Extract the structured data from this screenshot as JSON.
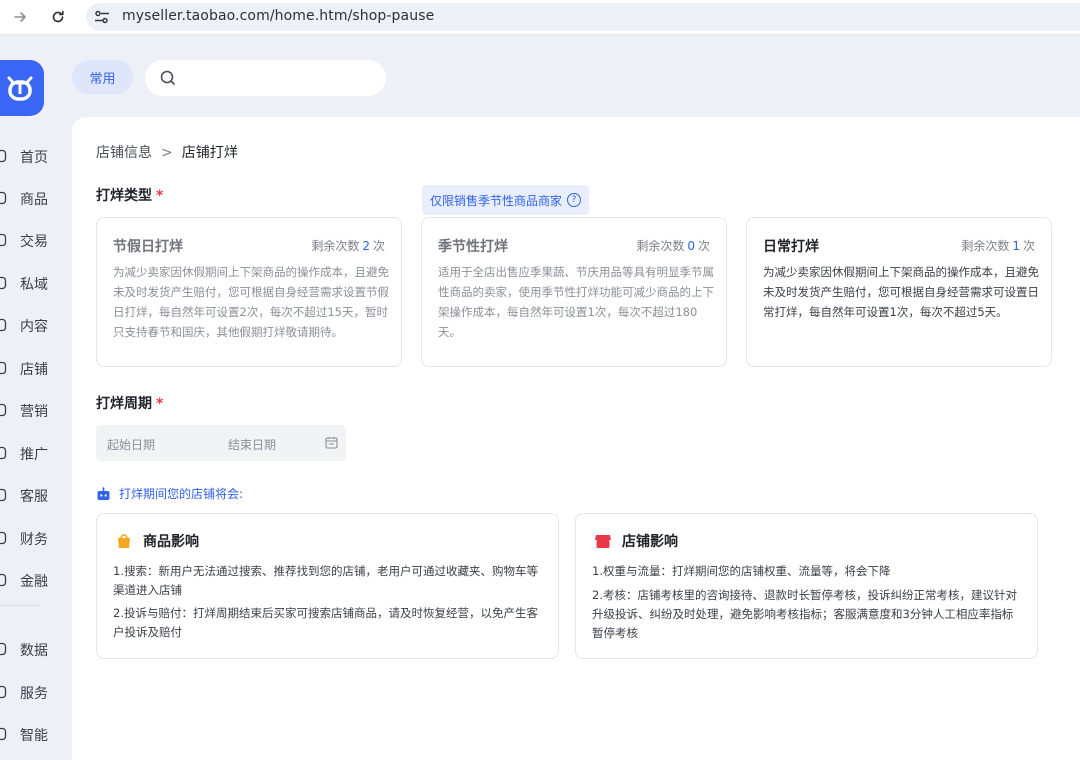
{
  "browser": {
    "url": "myseller.taobao.com/home.htm/shop-pause"
  },
  "sidebar": {
    "items": [
      {
        "label": "首页",
        "icon": "home-icon"
      },
      {
        "label": "商品",
        "icon": "goods-icon"
      },
      {
        "label": "交易",
        "icon": "trade-icon"
      },
      {
        "label": "私域",
        "icon": "private-domain-icon"
      },
      {
        "label": "内容",
        "icon": "content-icon"
      },
      {
        "label": "店铺",
        "icon": "shop-icon"
      },
      {
        "label": "营销",
        "icon": "marketing-icon"
      },
      {
        "label": "推广",
        "icon": "promotion-icon"
      },
      {
        "label": "客服",
        "icon": "service-icon"
      },
      {
        "label": "财务",
        "icon": "finance-icon"
      },
      {
        "label": "金融",
        "icon": "banking-icon"
      },
      {
        "label": "数据",
        "icon": "data-icon"
      },
      {
        "label": "服务",
        "icon": "services-icon"
      },
      {
        "label": "智能",
        "icon": "ai-icon"
      }
    ]
  },
  "toolbar": {
    "chip_label": "常用",
    "search_placeholder": ""
  },
  "breadcrumb": {
    "parent": "店铺信息",
    "separator": ">",
    "current": "店铺打烊"
  },
  "type_section": {
    "title": "打烊类型",
    "required_mark": "*",
    "seasonal_tag": "仅限销售季节性商品商家",
    "seasonal_tag_help": "?",
    "cards": [
      {
        "title": "节假日打烊",
        "remain_prefix": "剩余次数",
        "remain_count": "2",
        "remain_suffix": "次",
        "desc": "为减少卖家因休假期间上下架商品的操作成本，且避免未及时发货产生赔付，您可根据自身经营需求设置节假日打烊，每自然年可设置2次，每次不超过15天，暂时只支持春节和国庆，其他假期打烊敬请期待。",
        "active": false
      },
      {
        "title": "季节性打烊",
        "remain_prefix": "剩余次数",
        "remain_count": "0",
        "remain_suffix": "次",
        "desc": "适用于全店出售应季果蔬、节庆用品等具有明显季节属性商品的卖家，使用季节性打烊功能可减少商品的上下架操作成本，每自然年可设置1次，每次不超过180天。",
        "active": false
      },
      {
        "title": "日常打烊",
        "remain_prefix": "剩余次数",
        "remain_count": "1",
        "remain_suffix": "次",
        "desc": "为减少卖家因休假期间上下架商品的操作成本，且避免未及时发货产生赔付，您可根据自身经营需求可设置日常打烊，每自然年可设置1次，每次不超过5天。",
        "active": true
      }
    ]
  },
  "period_section": {
    "title": "打烊周期",
    "required_mark": "*",
    "start_placeholder": "起始日期",
    "end_placeholder": "结束日期"
  },
  "impact": {
    "notice": "打烊期间您的店铺将会:",
    "goods": {
      "title": "商品影响",
      "badge_color": "#f5a623",
      "lines": [
        "1.搜索：新用户无法通过搜索、推荐找到您的店铺，老用户可通过收藏夹、购物车等渠道进入店铺",
        "2.投诉与赔付：打烊周期结束后买家可搜索店铺商品，请及时恢复经营，以免产生客户投诉及赔付"
      ]
    },
    "shop": {
      "title": "店铺影响",
      "badge_color": "#e8394a",
      "lines": [
        "1.权重与流量：打烊期间您的店铺权重、流量等，将会下降",
        "2.考核：店铺考核里的咨询接待、退款时长暂停考核，投诉纠纷正常考核，建议针对升级投诉、纠纷及时处理，避免影响考核指标；客服满意度和3分钟人工相应率指标暂停考核"
      ]
    }
  },
  "colors": {
    "accent": "#3162e8",
    "required": "#e8393f",
    "logo": "#3b66f5"
  }
}
